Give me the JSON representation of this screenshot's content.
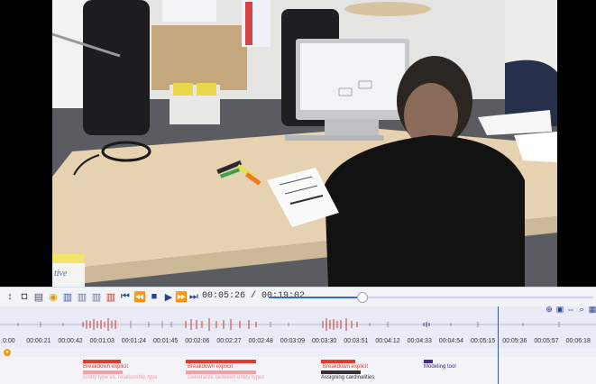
{
  "player": {
    "timecode": "00:05:26 / 00:19:02",
    "progress": 0.286
  },
  "toolbar_icons": [
    "mark-icon",
    "camera-icon",
    "document-icon",
    "highlight-icon",
    "tier-add-icon",
    "tier-icon",
    "tier-merge-icon",
    "tier-delete-icon",
    "skip-start-icon",
    "rewind-icon",
    "stop-icon",
    "play-icon",
    "fast-forward-icon",
    "skip-end-icon"
  ],
  "ruler_ticks": [
    "0:00",
    "00:00:21",
    "00:00:42",
    "00:01:03",
    "00:01:24",
    "00:01:45",
    "00:02:06",
    "00:02:27",
    "00:02:48",
    "00:03:09",
    "00:03:30",
    "00:03:51",
    "00:04:12",
    "00:04:33",
    "00:04:54",
    "00:05:15",
    "00:05:36",
    "00:05:57",
    "00:06:18"
  ],
  "annotations": {
    "breakdown_1": "Breakdown explicit",
    "entity_type": "Entity type vs. relationship type",
    "breakdown_2": "Breakdown explicit",
    "generalization": "Generalize between entity types",
    "breakdown_3": "Breakdown explicit",
    "assigning": "Assigning cardinalities",
    "modeling_tool": "Modeling tool"
  },
  "video_text": {
    "flyer": "tive"
  },
  "colors": {
    "accent": "#2f6bd8",
    "annotation_red": "#e33b2f",
    "annotation_pink": "#f4a0a4",
    "annotation_purple": "#4a2a8a",
    "annotation_dark": "#333333"
  }
}
